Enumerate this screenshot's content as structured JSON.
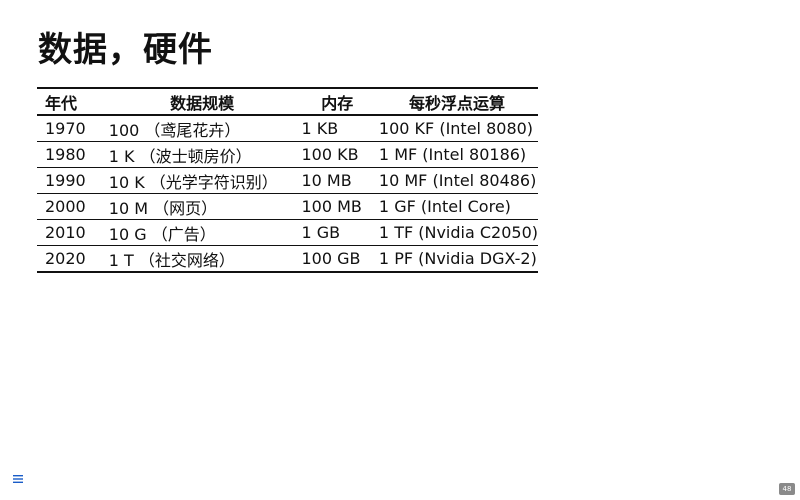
{
  "title": "数据，硬件",
  "table": {
    "headers": {
      "year": "年代",
      "scale": "数据规模",
      "memory": "内存",
      "flops": "每秒浮点运算"
    },
    "rows": [
      {
        "year": "1970",
        "scale": "100 （鸢尾花卉）",
        "memory": "1 KB",
        "flops": "100 KF (Intel 8080)"
      },
      {
        "year": "1980",
        "scale": "1 K （波士顿房价）",
        "memory": "100 KB",
        "flops": "1 MF (Intel 80186)"
      },
      {
        "year": "1990",
        "scale": "10 K （光学字符识别）",
        "memory": "10 MB",
        "flops": "10 MF (Intel 80486)"
      },
      {
        "year": "2000",
        "scale": "10 M （网页）",
        "memory": "100 MB",
        "flops": "1 GF (Intel Core)"
      },
      {
        "year": "2010",
        "scale": "10 G （广告）",
        "memory": "1 GB",
        "flops": "1 TF (Nvidia C2050)"
      },
      {
        "year": "2020",
        "scale": "1 T （社交网络）",
        "memory": "100 GB",
        "flops": "1 PF (Nvidia DGX-2)"
      }
    ]
  },
  "footer": {
    "menu_icon": "menu-icon",
    "page_number": "48"
  }
}
